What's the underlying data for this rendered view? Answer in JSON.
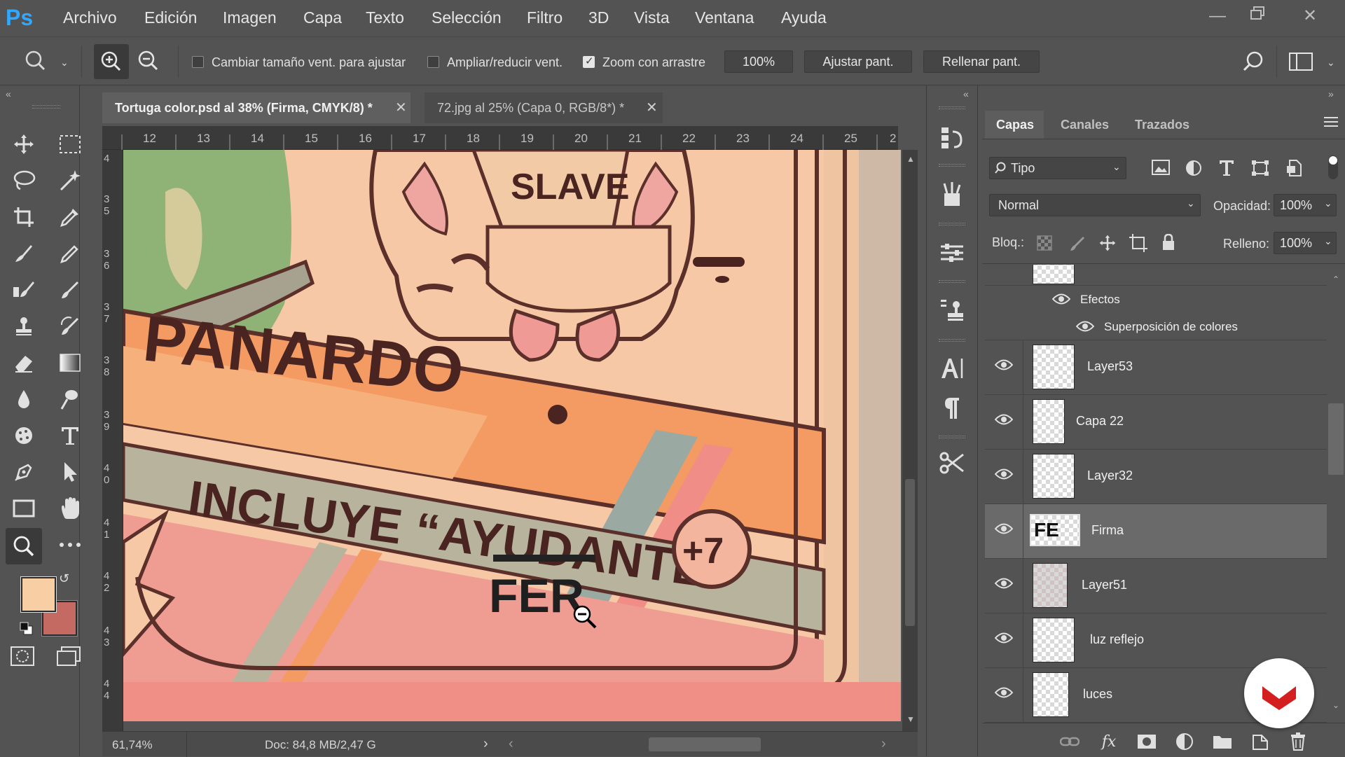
{
  "app": {
    "logo": "Ps",
    "menu": [
      "Archivo",
      "Edición",
      "Imagen",
      "Capa",
      "Texto",
      "Selección",
      "Filtro",
      "3D",
      "Vista",
      "Ventana",
      "Ayuda"
    ]
  },
  "options": {
    "resize_windows_label": "Cambiar tamaño vent. para ajustar",
    "resize_windows_checked": false,
    "zoom_all_label": "Ampliar/reducir vent.",
    "zoom_all_checked": false,
    "scrubby_zoom_label": "Zoom con arrastre",
    "scrubby_zoom_checked": true,
    "zoom_value": "100%",
    "fit_screen_label": "Ajustar pant.",
    "fill_screen_label": "Rellenar pant."
  },
  "documents": {
    "tabs": [
      {
        "label": "Tortuga color.psd al 38% (Firma, CMYK/8) *",
        "active": true
      },
      {
        "label": "72.jpg al 25% (Capa 0, RGB/8*) *",
        "active": false
      }
    ],
    "ruler_top": [
      "12",
      "13",
      "14",
      "15",
      "16",
      "17",
      "18",
      "19",
      "20",
      "21",
      "22",
      "23",
      "24",
      "25",
      "2"
    ],
    "ruler_left": [
      "4",
      "3 5",
      "3 6",
      "3 7",
      "3 8",
      "3 9",
      "4 0",
      "4 1",
      "4 2",
      "4 3",
      "4 4"
    ],
    "artwork_text": {
      "slave": "SLAVE",
      "panardo": "PANARDO",
      "incluye": "INCLUYE “AYUDANTE”",
      "plus": "+7",
      "signature": "FER"
    },
    "status": {
      "zoom": "61,74%",
      "doc_size": "Doc: 84,8 MB/2,47 G"
    }
  },
  "layers_panel": {
    "tabs": [
      "Capas",
      "Canales",
      "Trazados"
    ],
    "filter_kind": "Tipo",
    "blend_mode": "Normal",
    "opacity_label": "Opacidad:",
    "opacity_value": "100%",
    "lock_label": "Bloq.:",
    "fill_label": "Relleno:",
    "fill_value": "100%",
    "effects_label": "Efectos",
    "effect_item": "Superposición de colores",
    "layers": [
      {
        "name": "Layer53",
        "visible": true,
        "selected": false
      },
      {
        "name": "Capa 22",
        "visible": true,
        "selected": false
      },
      {
        "name": "Layer32",
        "visible": true,
        "selected": false
      },
      {
        "name": "Firma",
        "visible": true,
        "selected": true,
        "thumb_text": "FE"
      },
      {
        "name": "Layer51",
        "visible": true,
        "selected": false
      },
      {
        "name": "luz reflejo",
        "visible": true,
        "selected": false
      },
      {
        "name": "luces",
        "visible": true,
        "selected": false
      }
    ]
  },
  "colors": {
    "foreground": "#f8cfa5",
    "background": "#c56a63",
    "accent_red": "#d31f1f"
  }
}
